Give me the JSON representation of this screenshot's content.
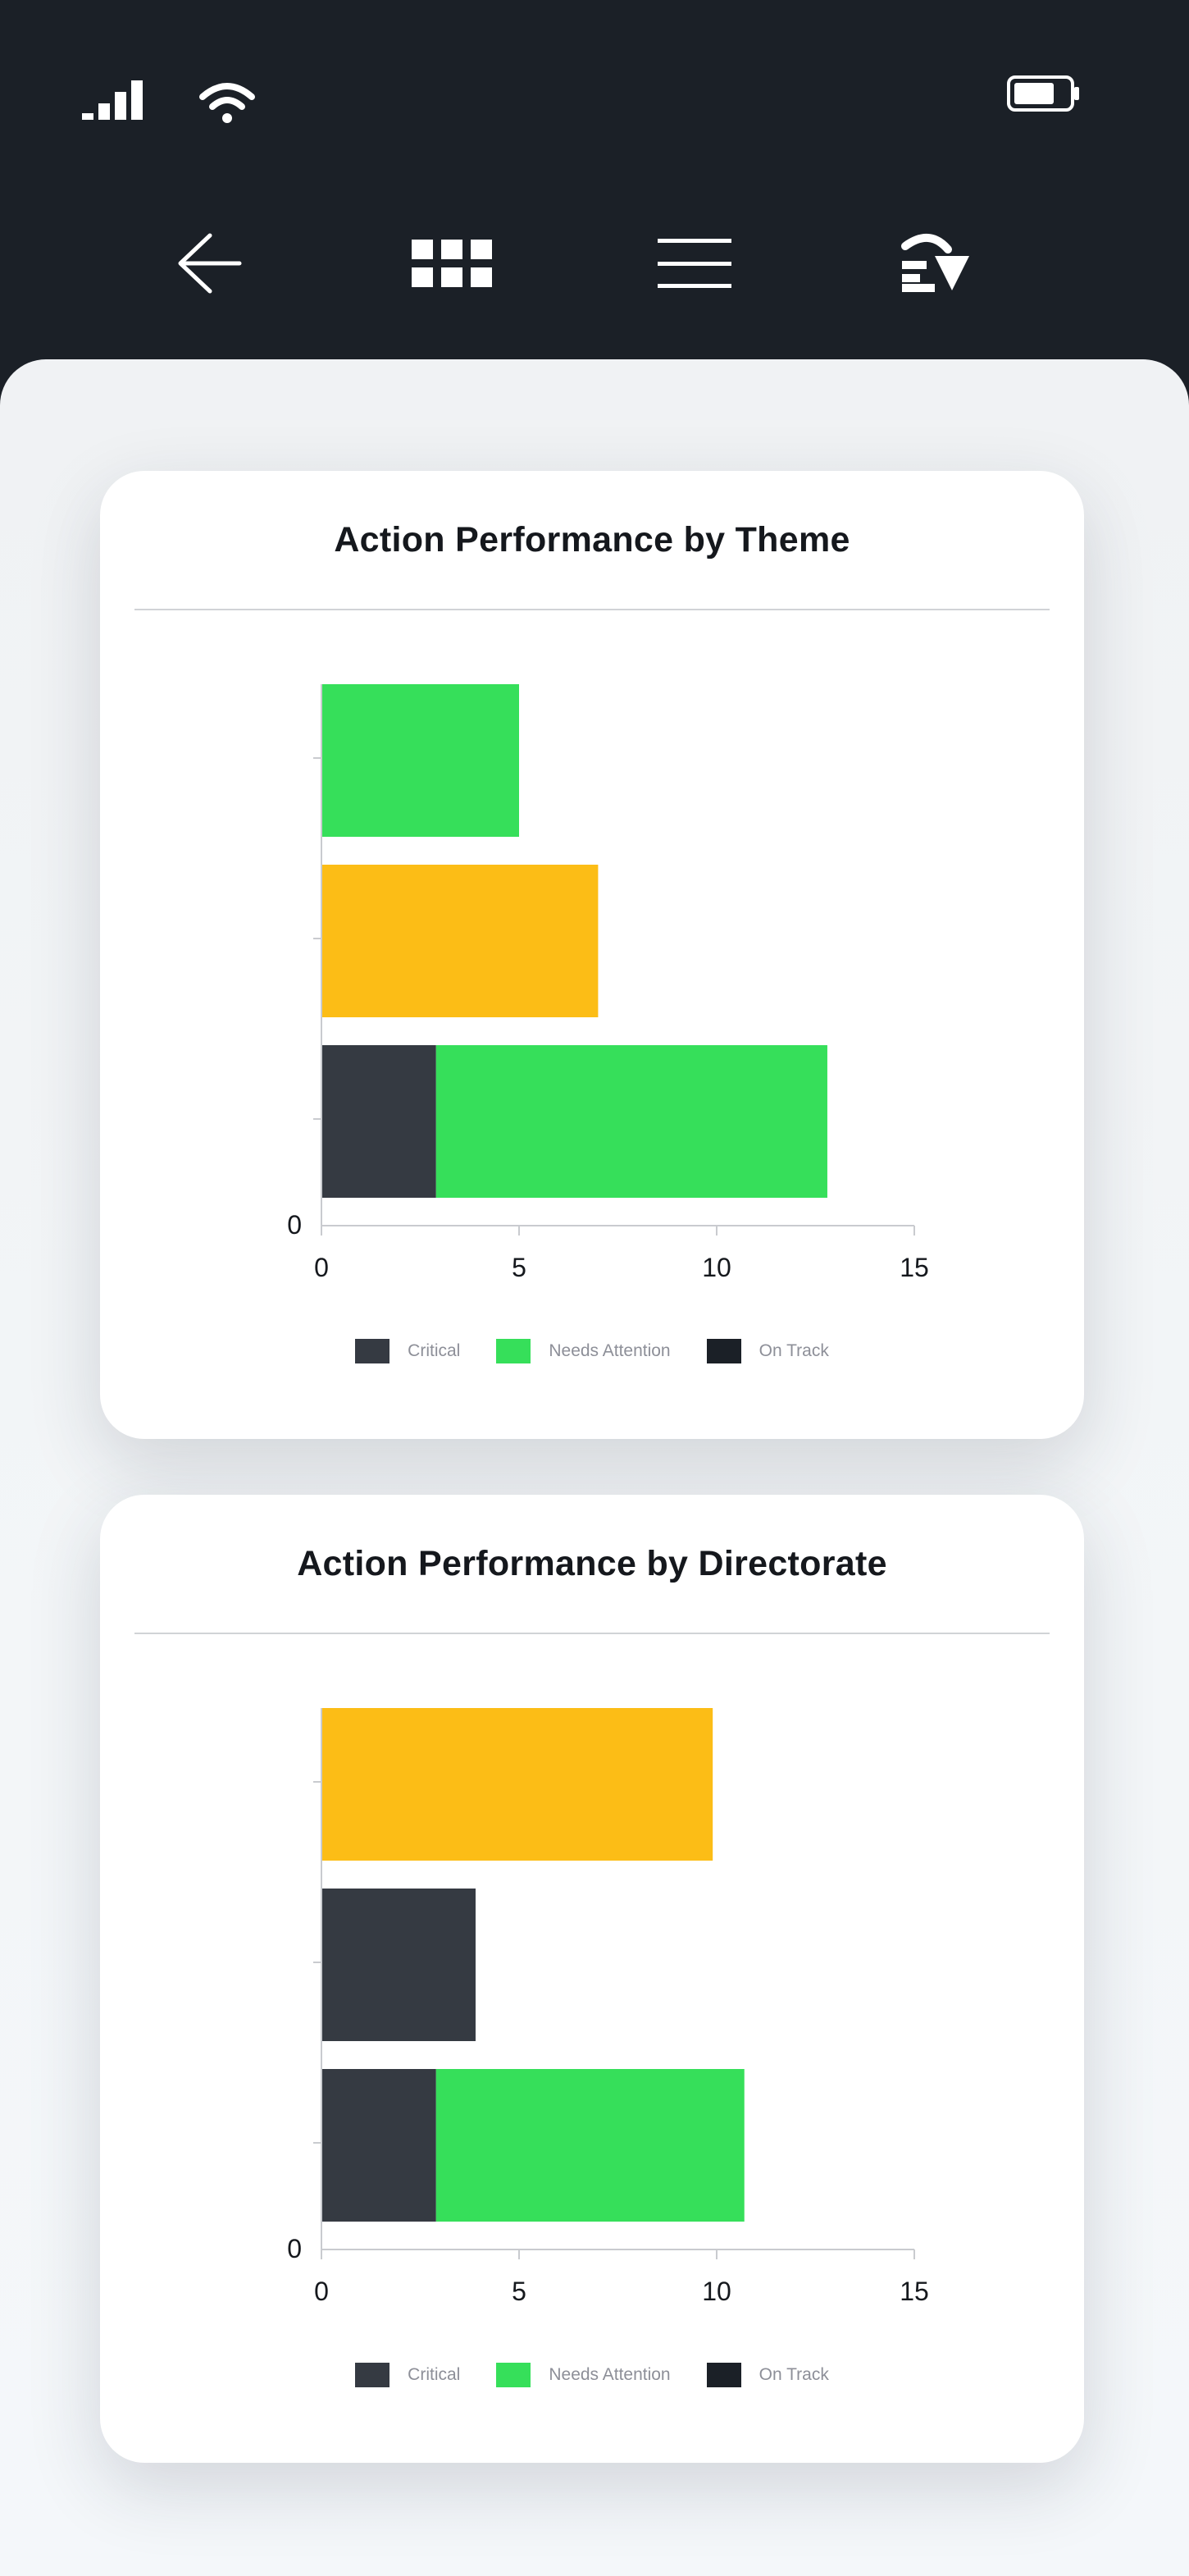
{
  "status_bar": {
    "signal_icon": "cellular-signal-icon",
    "wifi_icon": "wifi-icon",
    "battery_icon": "battery-icon"
  },
  "nav": {
    "back_icon": "arrow-left-icon",
    "grid_icon": "grid-icon",
    "menu_icon": "hamburger-menu-icon",
    "download_icon": "export-download-icon"
  },
  "colors": {
    "dark_background": "#1b2027",
    "critical": "#353a42",
    "needs_attention": "#36df5a",
    "on_track": "#1b2027",
    "amber_bar": "#fcbd16"
  },
  "charts": [
    {
      "title": "Action Performance by Theme",
      "chart_data": {
        "type": "bar",
        "orientation": "horizontal",
        "stacked": true,
        "title": "Action Performance by Theme",
        "xlim": [
          0,
          15
        ],
        "x_ticks": [
          "0",
          "5",
          "10",
          "15"
        ],
        "y_zero_label": "0",
        "grid": false,
        "legend_position": "bottom",
        "legend": [
          "Critical",
          "Needs Attention",
          "On Track"
        ],
        "bars": [
          {
            "segments": [
              {
                "value": 5,
                "color": "#36df5a"
              }
            ]
          },
          {
            "segments": [
              {
                "value": 7,
                "color": "#fcbd16"
              }
            ]
          },
          {
            "segments": [
              {
                "value": 2.9,
                "color": "#353a42"
              },
              {
                "value": 9.9,
                "color": "#36df5a"
              }
            ]
          }
        ]
      }
    },
    {
      "title": "Action Performance by Directorate",
      "chart_data": {
        "type": "bar",
        "orientation": "horizontal",
        "stacked": true,
        "title": "Action Performance by Directorate",
        "xlim": [
          0,
          15
        ],
        "x_ticks": [
          "0",
          "5",
          "10",
          "15"
        ],
        "y_zero_label": "0",
        "grid": false,
        "legend_position": "bottom",
        "legend": [
          "Critical",
          "Needs Attention",
          "On Track"
        ],
        "bars": [
          {
            "segments": [
              {
                "value": 9.9,
                "color": "#fcbd16"
              }
            ]
          },
          {
            "segments": [
              {
                "value": 3.9,
                "color": "#353a42"
              }
            ]
          },
          {
            "segments": [
              {
                "value": 2.9,
                "color": "#353a42"
              },
              {
                "value": 7.8,
                "color": "#36df5a"
              }
            ]
          }
        ]
      }
    }
  ],
  "legend": [
    {
      "label": "Critical",
      "color": "#353a42"
    },
    {
      "label": "Needs Attention",
      "color": "#36df5a"
    },
    {
      "label": "On Track",
      "color": "#1b2027"
    }
  ]
}
